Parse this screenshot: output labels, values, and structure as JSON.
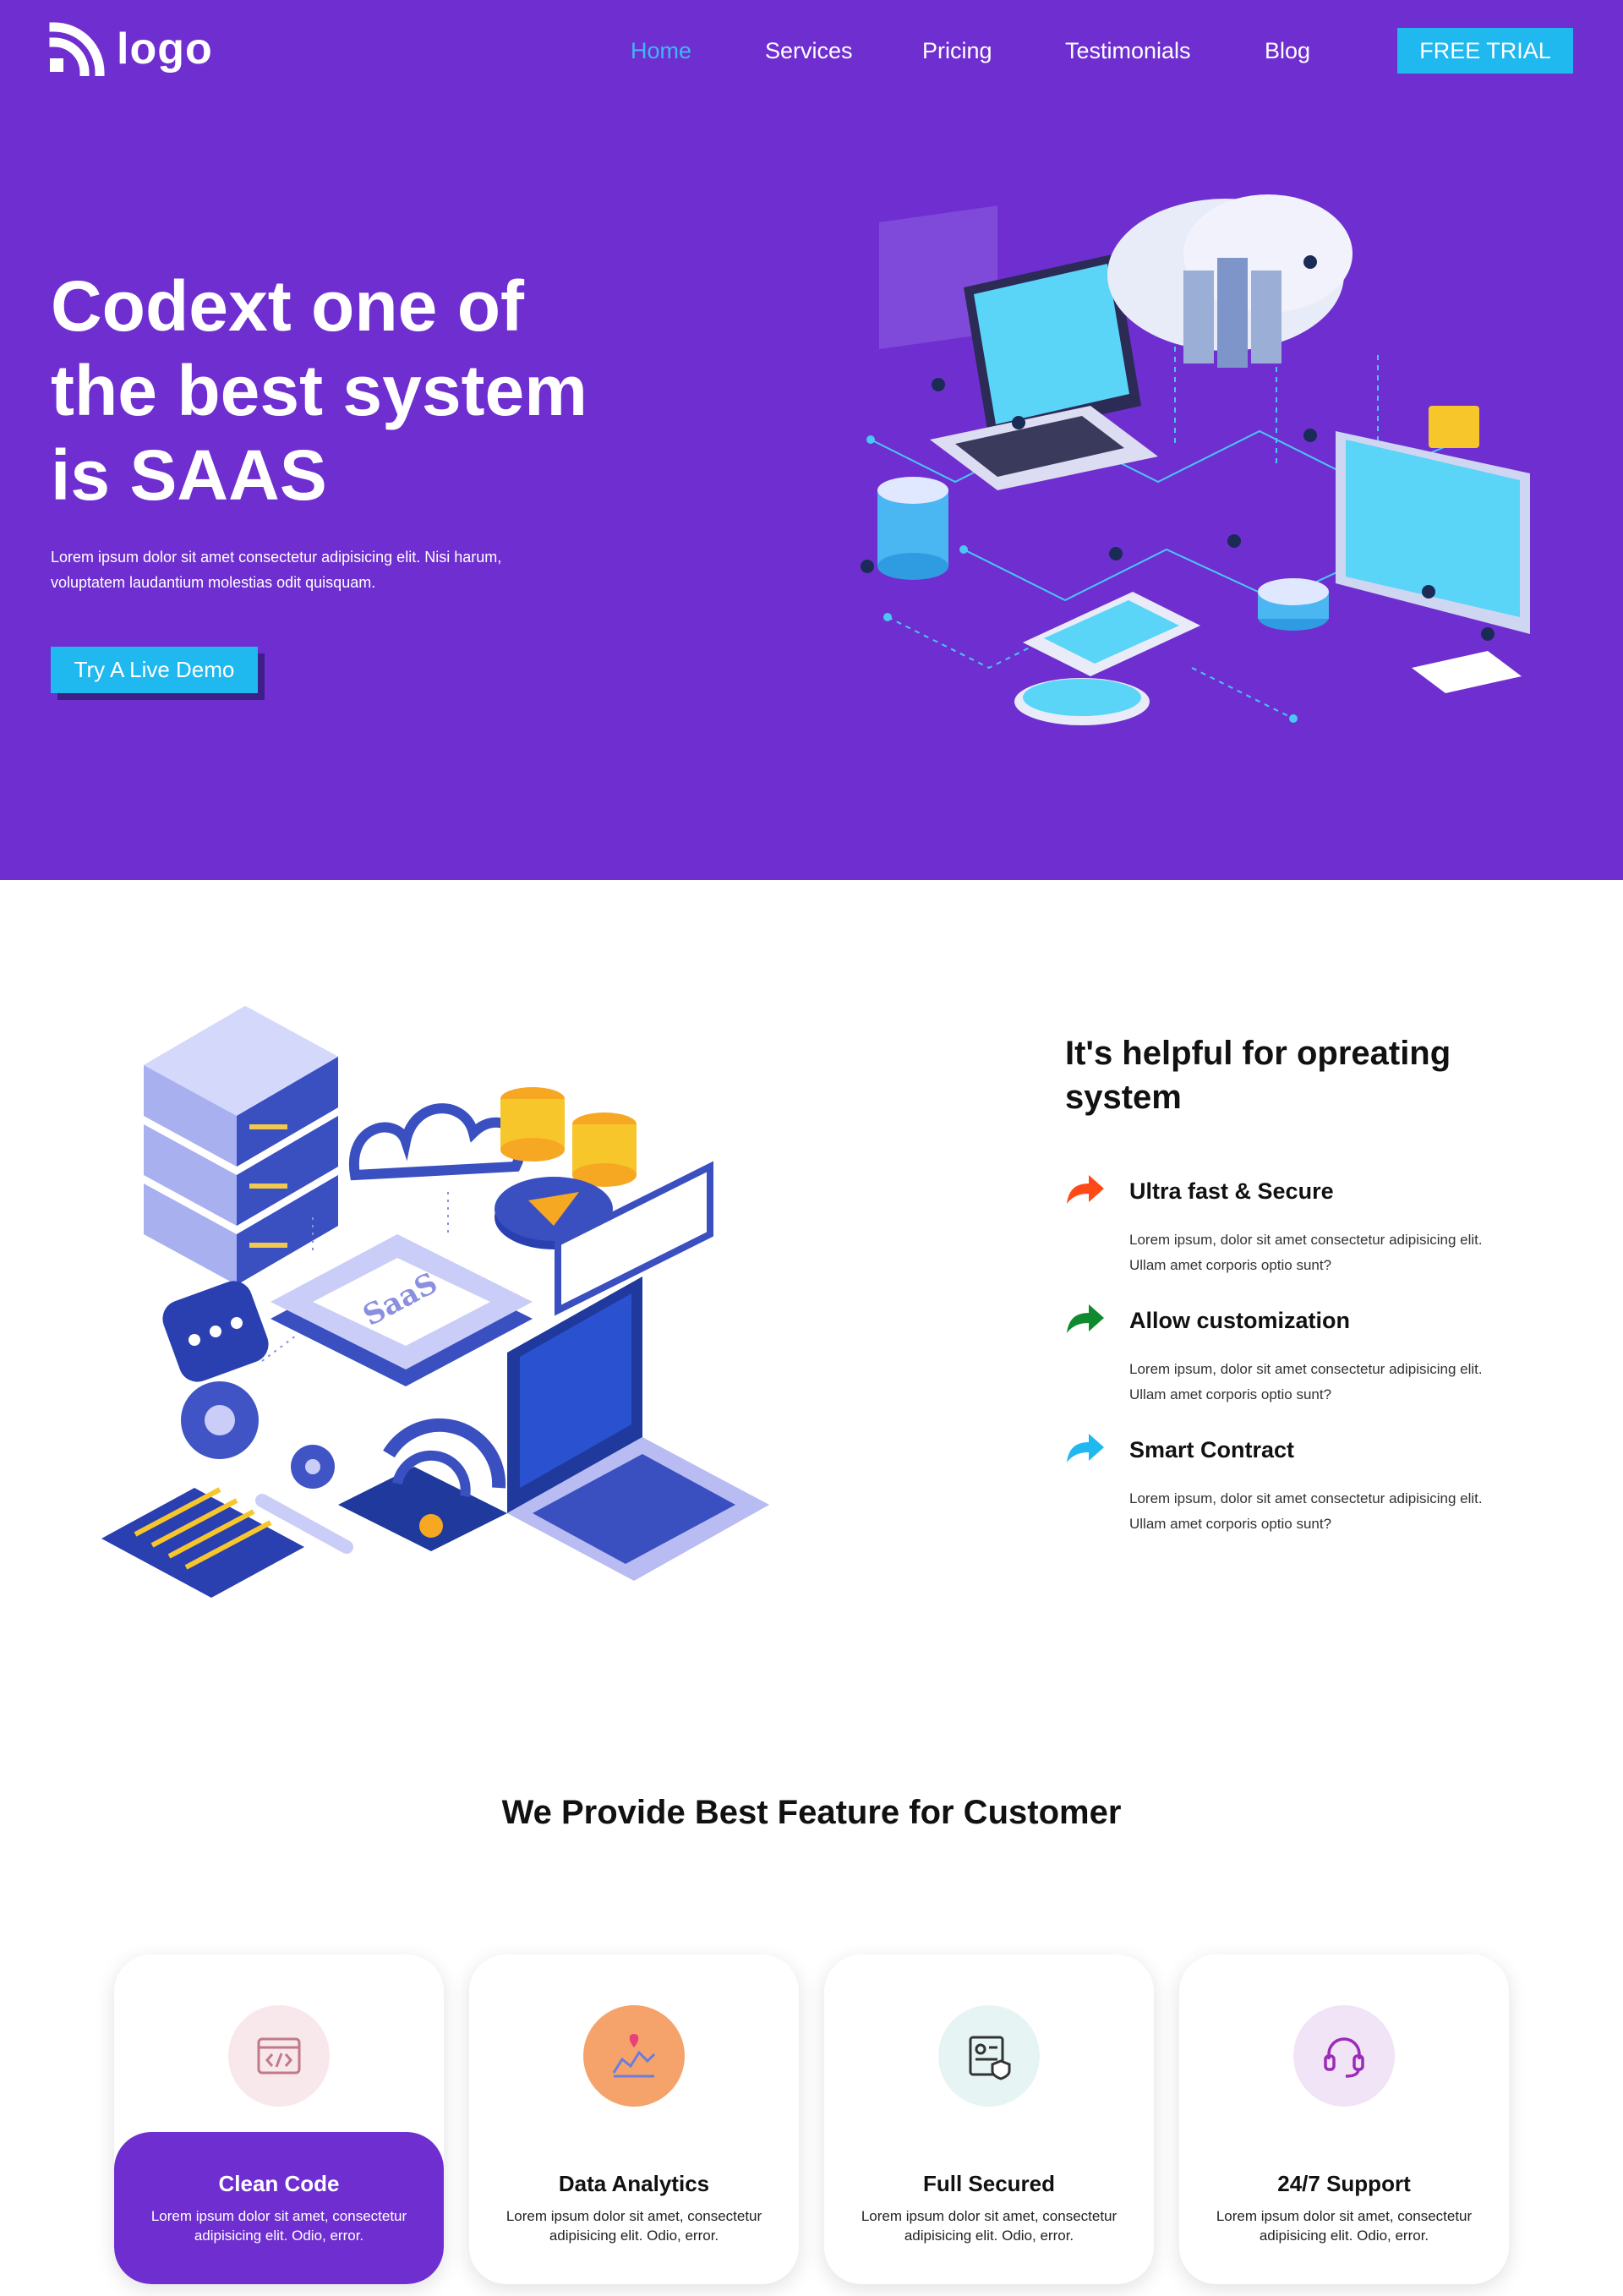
{
  "nav": {
    "logo_text": "logo",
    "links": [
      "Home",
      "Services",
      "Pricing",
      "Testimonials",
      "Blog"
    ],
    "active_link": "Home",
    "cta": "FREE TRIAL"
  },
  "hero": {
    "title": "Codext one of the best system is SAAS",
    "text": "Lorem ipsum dolor sit amet consectetur adipisicing elit. Nisi harum, voluptatem laudantium molestias odit quisquam.",
    "button": "Try A Live Demo"
  },
  "section_helpful": {
    "illustration_label": "SaaS",
    "title": "It's helpful for opreating system",
    "features": [
      {
        "icon": "share-arrow-icon",
        "color": "#ff4a17",
        "name": "Ultra fast & Secure",
        "desc": "Lorem ipsum, dolor sit amet consectetur adipisicing elit. Ullam amet corporis optio sunt?"
      },
      {
        "icon": "share-arrow-icon",
        "color": "#0f8a2e",
        "name": "Allow customization",
        "desc": "Lorem ipsum, dolor sit amet consectetur adipisicing elit. Ullam amet corporis optio sunt?"
      },
      {
        "icon": "share-arrow-icon",
        "color": "#1fb8ef",
        "name": "Smart Contract",
        "desc": "Lorem ipsum, dolor sit amet consectetur adipisicing elit. Ullam amet corporis optio sunt?"
      }
    ]
  },
  "section_features": {
    "title": "We Provide Best Feature for Customer",
    "cards": [
      {
        "icon": "code-window-icon",
        "title": "Clean Code",
        "text": "Lorem ipsum dolor sit amet, consectetur adipisicing elit. Odio, error.",
        "active": true
      },
      {
        "icon": "chart-pin-icon",
        "title": "Data Analytics",
        "text": "Lorem ipsum dolor sit amet, consectetur adipisicing elit. Odio, error.",
        "active": false
      },
      {
        "icon": "secure-document-icon",
        "title": "Full Secured",
        "text": "Lorem ipsum dolor sit amet, consectetur adipisicing elit. Odio, error.",
        "active": false
      },
      {
        "icon": "headset-icon",
        "title": "24/7 Support",
        "text": "Lorem ipsum dolor sit amet, consectetur adipisicing elit. Odio, error.",
        "active": false
      }
    ]
  },
  "colors": {
    "primary": "#6f2fd0",
    "accent": "#1fb8ef",
    "nav_active": "#3fb7f2"
  }
}
